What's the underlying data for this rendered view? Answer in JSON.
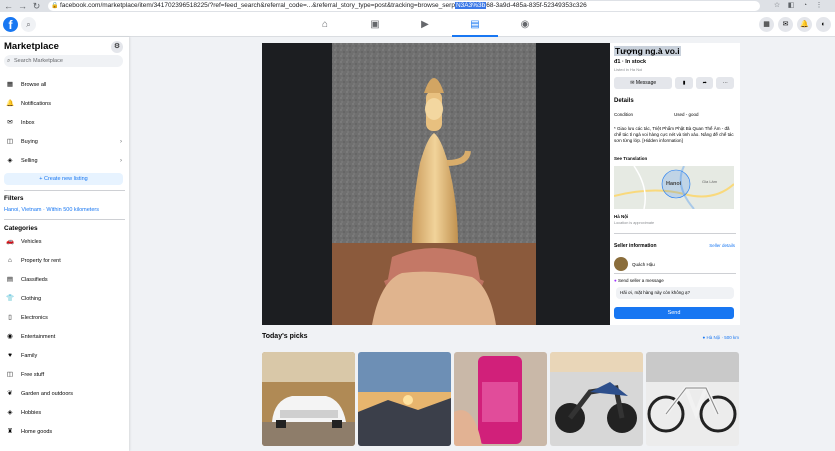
{
  "browser": {
    "url_prefix": "facebook.com/marketplace/item/341702396518225/?ref=feed_search&referral_code=...&referral_story_type=post&tracking=browse_serp",
    "url_selected": "N3A3%3b",
    "url_rest": "68-3a9d-485a-835f-52349353c326"
  },
  "topbar": {
    "logo": "f",
    "tabs": [
      "home",
      "watch",
      "video",
      "marketplace",
      "groups"
    ]
  },
  "sidebar": {
    "title": "Marketplace",
    "search_placeholder": "Search Marketplace",
    "items": [
      {
        "label": "Browse all",
        "icon": "store-icon"
      },
      {
        "label": "Notifications",
        "icon": "bell-icon"
      },
      {
        "label": "Inbox",
        "icon": "inbox-icon"
      },
      {
        "label": "Buying",
        "icon": "bag-icon",
        "chevron": true
      },
      {
        "label": "Selling",
        "icon": "tag-icon",
        "chevron": true
      }
    ],
    "create_listing": "+ Create new listing",
    "filters_label": "Filters",
    "location": "Hanoi, Vietnam · Within 500 kilometers",
    "categories_label": "Categories",
    "categories": [
      "Vehicles",
      "Property for rent",
      "Classifieds",
      "Clothing",
      "Electronics",
      "Entertainment",
      "Family",
      "Free stuff",
      "Garden and outdoors",
      "Hobbies",
      "Home goods"
    ]
  },
  "listing": {
    "title": "Tượng ng.à vo.i",
    "price": "đ1 · In stock",
    "listed": "Listed in Ha Noi",
    "message_btn": "Message",
    "details_label": "Details",
    "condition_label": "Condition",
    "condition_value": "Used - good",
    "description": "* Giao lưu các tác, Triệt Phẩm Phật Bà Quan Thế Âm - đã chế tác tỉ ngà voi hàng cực nét và tinh xảo. Nâng đế chế tác sơn từng lớp. [Hidden information]",
    "see_translation": "See Translation",
    "map_label": "Hanoi",
    "map_sub": "Gia Lâm",
    "loc_name": "Hà Nội",
    "loc_note": "Location is approximate",
    "seller_info": "Seller information",
    "seller_details": "Seller details",
    "seller_name": "Quách Hậu",
    "send_seller": "Send seller a message",
    "input_value": "Hãi ơi, mặt hàng này còn không ạ?",
    "send_btn": "Send"
  },
  "picks": {
    "title": "Today's picks",
    "location": "Hà Nội · 500 km"
  }
}
